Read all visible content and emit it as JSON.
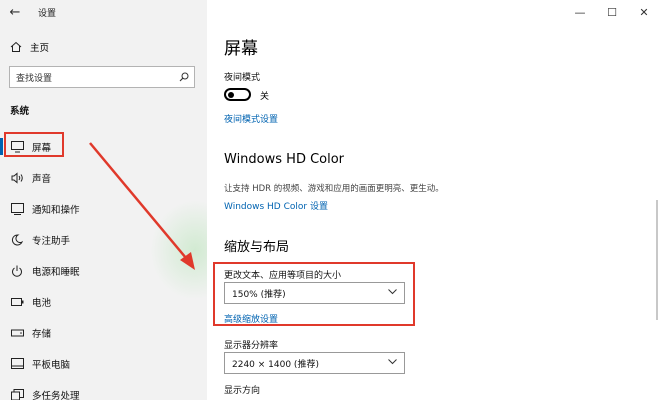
{
  "window": {
    "title": "设置",
    "back_glyph": "←",
    "minimize_glyph": "—",
    "maximize_glyph": "☐",
    "close_glyph": "✕"
  },
  "sidebar": {
    "home_label": "主页",
    "search_placeholder": "查找设置",
    "section_label": "系统",
    "items": [
      {
        "label": "屏幕",
        "icon": "monitor-icon",
        "active": true
      },
      {
        "label": "声音",
        "icon": "speaker-icon",
        "active": false
      },
      {
        "label": "通知和操作",
        "icon": "notification-icon",
        "active": false
      },
      {
        "label": "专注助手",
        "icon": "moon-icon",
        "active": false
      },
      {
        "label": "电源和睡眠",
        "icon": "power-icon",
        "active": false
      },
      {
        "label": "电池",
        "icon": "battery-icon",
        "active": false
      },
      {
        "label": "存储",
        "icon": "storage-icon",
        "active": false
      },
      {
        "label": "平板电脑",
        "icon": "tablet-icon",
        "active": false
      },
      {
        "label": "多任务处理",
        "icon": "multitask-icon",
        "active": false
      }
    ]
  },
  "main": {
    "page_title": "屏幕",
    "night_light": {
      "label": "夜间模式",
      "state": "关",
      "settings_link": "夜间模式设置"
    },
    "hdr": {
      "heading": "Windows HD Color",
      "description": "让支持 HDR 的视频、游戏和应用的画面更明亮、更生动。",
      "settings_link": "Windows HD Color 设置"
    },
    "scale_layout": {
      "heading": "缩放与布局",
      "scale_label": "更改文本、应用等项目的大小",
      "scale_value": "150% (推荐)",
      "advanced_link": "高级缩放设置",
      "resolution_label": "显示器分辨率",
      "resolution_value": "2240 × 1400 (推荐)",
      "orientation_label": "显示方向"
    }
  },
  "colors": {
    "accent": "#0063b1",
    "highlight": "#e0392b",
    "sidebar_bg": "#f2f2f2"
  }
}
